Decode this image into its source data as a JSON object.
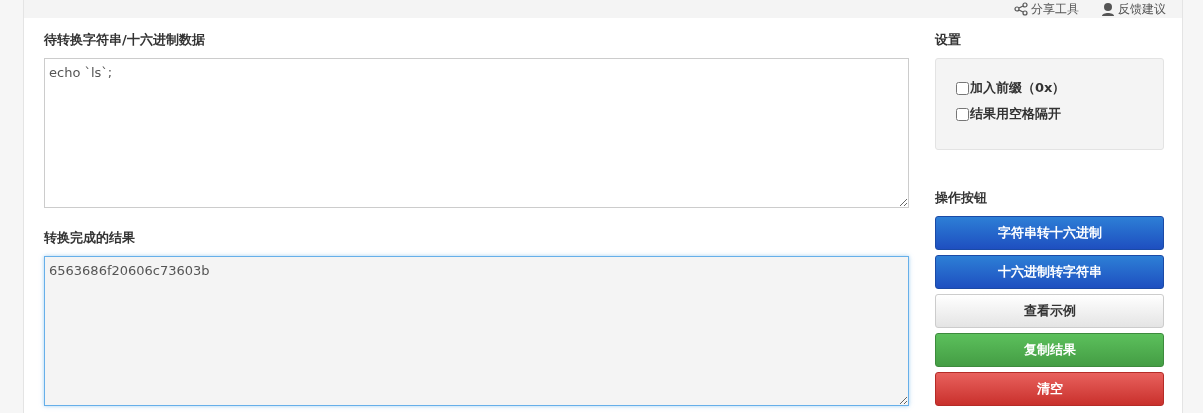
{
  "top_links": [
    {
      "kind": "share",
      "label": "分享工具"
    },
    {
      "kind": "feedback",
      "label": "反馈建议"
    }
  ],
  "input": {
    "label": "待转换字符串/十六进制数据",
    "value": "echo `ls`;"
  },
  "output": {
    "label": "转换完成的结果",
    "value": "6563686f20606c73603b"
  },
  "settings": {
    "title": "设置",
    "options": [
      {
        "label": "加入前缀（0x）",
        "checked": false
      },
      {
        "label": "结果用空格隔开",
        "checked": false
      }
    ]
  },
  "actions": {
    "title": "操作按钮",
    "buttons": [
      {
        "label": "字符串转十六进制",
        "kind": "primary"
      },
      {
        "label": "十六进制转字符串",
        "kind": "primary"
      },
      {
        "label": "查看示例",
        "kind": "default"
      },
      {
        "label": "复制结果",
        "kind": "success"
      },
      {
        "label": "清空",
        "kind": "danger"
      }
    ]
  }
}
